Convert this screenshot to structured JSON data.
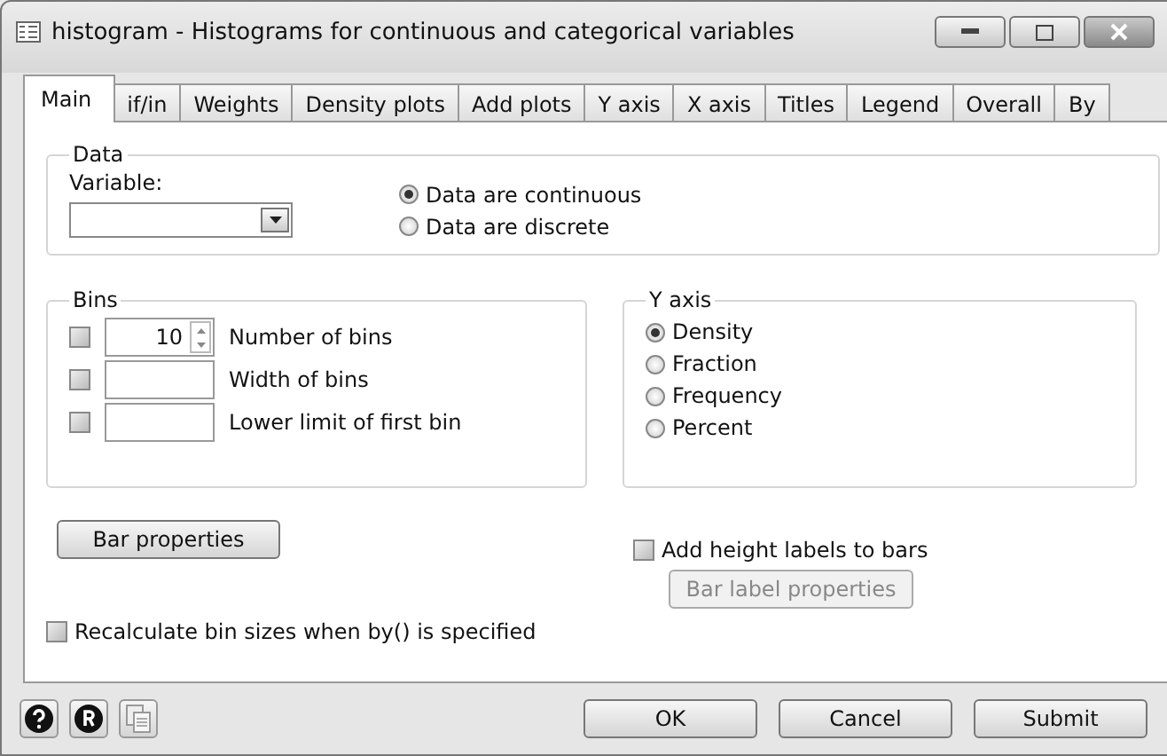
{
  "window": {
    "title": "histogram - Histograms for continuous and categorical variables"
  },
  "tabs": [
    {
      "label": "Main",
      "selected": true
    },
    {
      "label": "if/in",
      "selected": false
    },
    {
      "label": "Weights",
      "selected": false
    },
    {
      "label": "Density plots",
      "selected": false
    },
    {
      "label": "Add plots",
      "selected": false
    },
    {
      "label": "Y axis",
      "selected": false
    },
    {
      "label": "X axis",
      "selected": false
    },
    {
      "label": "Titles",
      "selected": false
    },
    {
      "label": "Legend",
      "selected": false
    },
    {
      "label": "Overall",
      "selected": false
    },
    {
      "label": "By",
      "selected": false
    }
  ],
  "data_group": {
    "title": "Data",
    "variable_label": "Variable:",
    "options": [
      {
        "label": "Data are continuous",
        "selected": true
      },
      {
        "label": "Data are discrete",
        "selected": false
      }
    ]
  },
  "bins_group": {
    "title": "Bins",
    "rows": [
      {
        "label": "Number of bins",
        "checked": false,
        "value": "10",
        "kind": "spinner"
      },
      {
        "label": "Width of bins",
        "checked": false,
        "kind": "text"
      },
      {
        "label": "Lower limit of first bin",
        "checked": false,
        "kind": "text"
      }
    ]
  },
  "y_axis_group": {
    "title": "Y axis",
    "options": [
      {
        "label": "Density",
        "selected": true
      },
      {
        "label": "Fraction",
        "selected": false
      },
      {
        "label": "Frequency",
        "selected": false
      },
      {
        "label": "Percent",
        "selected": false
      }
    ]
  },
  "bar_properties_button": "Bar properties",
  "height_labels": {
    "label": "Add height labels to bars",
    "checked": false
  },
  "bar_label_properties_button": {
    "label": "Bar label properties",
    "disabled": true
  },
  "recalculate": {
    "label": "Recalculate bin sizes when by() is specified",
    "checked": false
  },
  "footer_buttons": [
    "OK",
    "Cancel",
    "Submit"
  ]
}
